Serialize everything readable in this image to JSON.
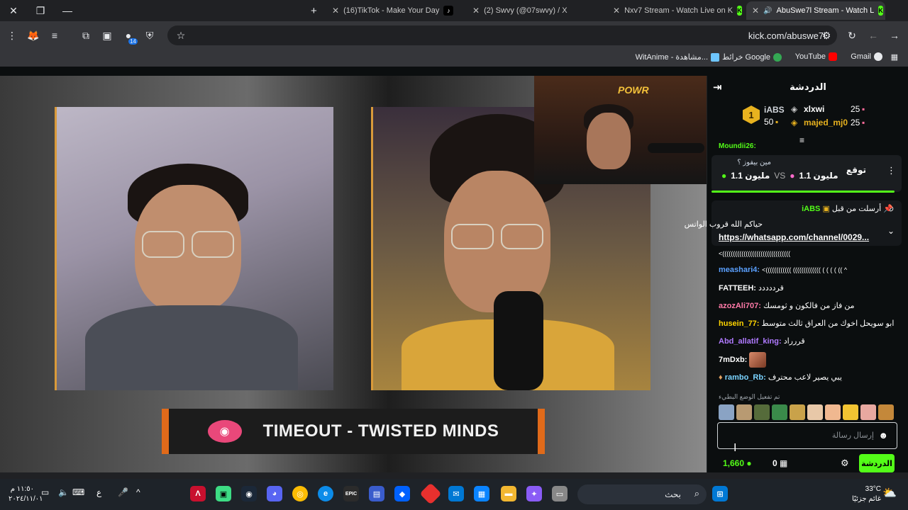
{
  "browser": {
    "tabs": [
      {
        "title": "(16)TikTok - Make Your Day"
      },
      {
        "title": "(2) Swvy (@07swvy) / X"
      },
      {
        "title": "Nxv7 Stream - Watch Live on K"
      },
      {
        "title": "AbuSwe7l Stream - Watch L"
      }
    ],
    "url": "kick.com/abuswe7l",
    "extension_badge": "14",
    "bookmarks": {
      "gmail": "Gmail",
      "youtube": "YouTube",
      "maps": "خرائط Google",
      "witanime": "WitAnime - مشاهدة..."
    }
  },
  "stream": {
    "overlay_neon": "POWR",
    "banner_text": "TIMEOUT - TWISTED MINDS"
  },
  "chat": {
    "title": "الدردشة",
    "leaderboard": {
      "rank": "1",
      "top_user": "iABS",
      "top_amount": "50",
      "second_user": "xlxwi",
      "second_amount": "25",
      "third_user": "majed_mj0",
      "third_amount": "25"
    },
    "partial_msg": "Moundii26:",
    "prediction": {
      "question": "مين بيفوز ؟",
      "option_a": "مليون 1.1",
      "vs": "VS",
      "option_b": "مليون 1.1",
      "button": "توقع"
    },
    "pinned": {
      "label": "أرسلت من قبل",
      "user": "iABS",
      "message": "حياكم الله قروب الواتس",
      "link": "https://whatsapp.com/channel/0029..."
    },
    "messages": [
      {
        "user": "",
        "text": "<((((((((((((((((((((((((((((((((",
        "color": "#fff"
      },
      {
        "user": "meashari4:",
        "text": "<(((((((((((( ((((((((((((( ( ( ( ( (( ^",
        "color": "#5aa0ff"
      },
      {
        "user": "FATTEEH:",
        "text": "قرددددد",
        "color": "#ffffff"
      },
      {
        "user": "azozAli707:",
        "text": "من فاز من فالكون و ثومسك",
        "color": "#ff7aa8"
      },
      {
        "user": "husein_77:",
        "text": "ابو سويحل اخوك من العراق ثالث متوسط",
        "color": "#ffd400"
      },
      {
        "user": "Abd_allatif_king:",
        "text": "قررراد",
        "color": "#b07aff"
      },
      {
        "user": "7mDxb:",
        "text": "",
        "color": "#ffffff"
      },
      {
        "user": "rambo_Rb:",
        "text": "يبي يصير لاعب محترف",
        "color": "#7ad3ff"
      }
    ],
    "emote_note": "تم تفعيل الوضع البطيء",
    "input_placeholder": "إرسال رسالة",
    "points": "1,660",
    "zero_count": "0",
    "send_button": "الدردشة"
  },
  "taskbar": {
    "search_label": "بحث",
    "time": "١١:٥٠ م",
    "date": "٢٠٢٤/١١/٠١",
    "lang": "ع",
    "weather_temp": "33°C",
    "weather_desc": "غائم جزئيًا"
  }
}
